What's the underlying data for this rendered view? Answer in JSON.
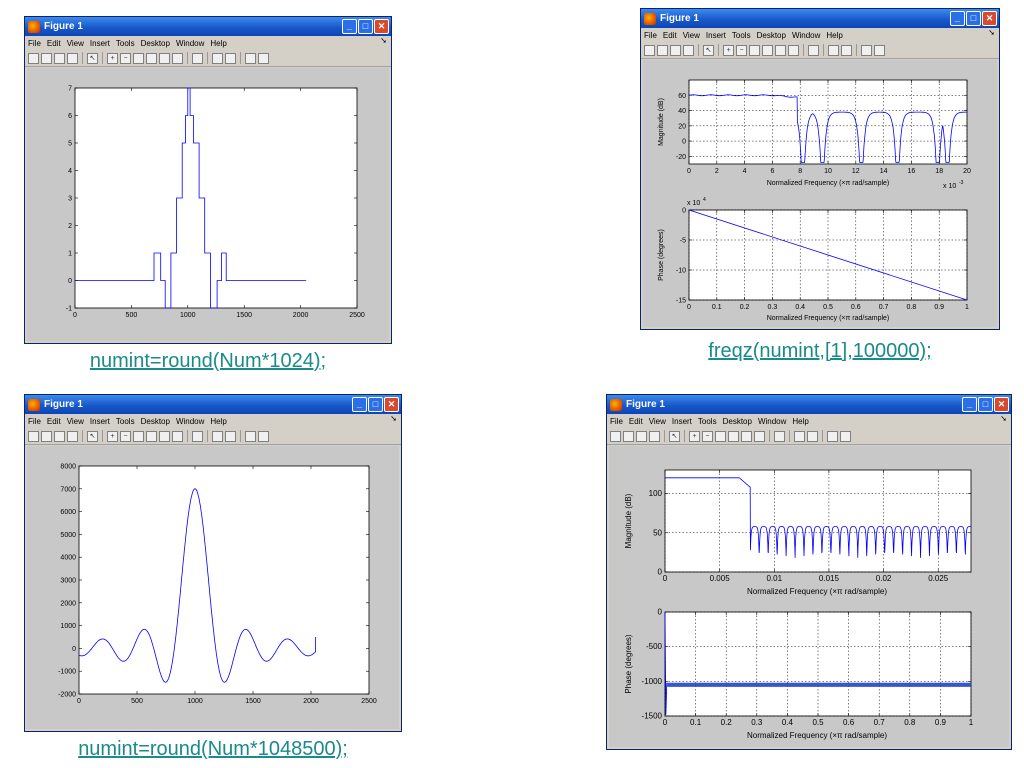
{
  "window_title": "Figure 1",
  "menu": [
    "File",
    "Edit",
    "View",
    "Insert",
    "Tools",
    "Desktop",
    "Window",
    "Help"
  ],
  "captions": {
    "a": "numint=round(Num*1024);",
    "b": "freqz(numint,[1],100000);",
    "c": "numint=round(Num*1048500);",
    "d": ""
  },
  "labels": {
    "magnitude": "Magnitude (dB)",
    "phase": "Phase (degrees)",
    "freq": "Normalized Frequency  (×π rad/sample)",
    "exp_x": "x 10",
    "exp_x_pow": "-3",
    "exp_y": "x 10",
    "exp_y_pow": "4"
  },
  "chart_data": [
    {
      "id": "fig-a",
      "type": "line",
      "x": [
        0,
        700,
        700,
        760,
        760,
        800,
        800,
        850,
        850,
        900,
        900,
        950,
        950,
        980,
        980,
        1000,
        1000,
        1020,
        1020,
        1050,
        1050,
        1100,
        1100,
        1150,
        1150,
        1200,
        1200,
        1260,
        1260,
        1300,
        1300,
        1340,
        1340,
        2050
      ],
      "y": [
        0,
        0,
        1,
        1,
        0,
        0,
        -1,
        -1,
        1,
        1,
        3,
        3,
        5,
        5,
        6,
        6,
        7,
        7,
        6,
        6,
        5,
        5,
        3,
        3,
        1,
        1,
        -1,
        -1,
        0,
        0,
        1,
        1,
        0,
        0
      ],
      "xlim": [
        0,
        2500
      ],
      "ylim": [
        -1,
        7
      ],
      "xticks": [
        0,
        500,
        1000,
        1500,
        2000,
        2500
      ],
      "yticks": [
        -1,
        0,
        1,
        2,
        3,
        4,
        5,
        6,
        7
      ],
      "grid": false
    },
    {
      "id": "fig-b-mag",
      "type": "line",
      "xlim": [
        0,
        20
      ],
      "ylim": [
        -30,
        80
      ],
      "xticks": [
        0,
        2,
        4,
        6,
        8,
        10,
        12,
        14,
        16,
        18,
        20
      ],
      "yticks": [
        -20,
        0,
        20,
        40,
        60
      ],
      "grid": true,
      "passband_db": 60,
      "passband_edge": 7.8,
      "nulls": [
        8.2,
        9.6,
        12.4,
        15.0,
        17.9,
        18.6
      ]
    },
    {
      "id": "fig-b-phase",
      "type": "line",
      "x": [
        0,
        1
      ],
      "y": [
        0,
        -15
      ],
      "xlim": [
        0,
        1
      ],
      "ylim": [
        -15,
        0
      ],
      "xticks": [
        0,
        0.1,
        0.2,
        0.3,
        0.4,
        0.5,
        0.6,
        0.7,
        0.8,
        0.9,
        1
      ],
      "yticks": [
        -15,
        -10,
        -5,
        0
      ],
      "grid": true
    },
    {
      "id": "fig-c",
      "type": "line",
      "xlim": [
        0,
        2500
      ],
      "ylim": [
        -2000,
        8000
      ],
      "xticks": [
        0,
        500,
        1000,
        1500,
        2000,
        2500
      ],
      "yticks": [
        -2000,
        -1000,
        0,
        1000,
        2000,
        3000,
        4000,
        5000,
        6000,
        7000,
        8000
      ],
      "grid": false,
      "peak": 7000,
      "center": 1000
    },
    {
      "id": "fig-d-mag",
      "type": "line",
      "xlim": [
        0,
        0.028
      ],
      "ylim": [
        0,
        130
      ],
      "xticks": [
        0,
        0.005,
        0.01,
        0.015,
        0.02,
        0.025
      ],
      "yticks": [
        0,
        50,
        100
      ],
      "grid": true,
      "passband_db": 120,
      "passband_edge": 0.0078,
      "stopband_db": 58
    },
    {
      "id": "fig-d-phase",
      "type": "line",
      "xlim": [
        0,
        1
      ],
      "ylim": [
        -1500,
        0
      ],
      "xticks": [
        0,
        0.1,
        0.2,
        0.3,
        0.4,
        0.5,
        0.6,
        0.7,
        0.8,
        0.9,
        1
      ],
      "yticks": [
        -1500,
        -1000,
        -500,
        0
      ],
      "grid": true,
      "band_center": -1050,
      "band_half": 30
    }
  ]
}
